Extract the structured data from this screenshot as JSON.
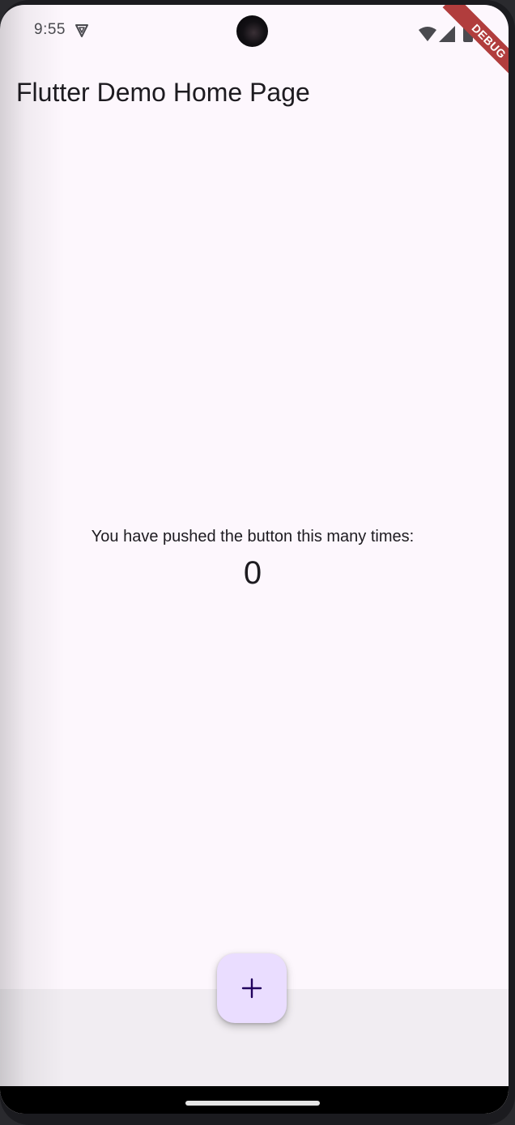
{
  "status_bar": {
    "time": "9:55",
    "icons": [
      "vpn-icon",
      "wifi-icon",
      "signal-icon",
      "battery-icon"
    ]
  },
  "debug_banner": {
    "label": "DEBUG",
    "color": "#b13d3d"
  },
  "app_bar": {
    "title": "Flutter Demo Home Page"
  },
  "body": {
    "message": "You have pushed the button this many times:",
    "counter": "0"
  },
  "fab": {
    "icon": "plus-icon",
    "color": "#eaddff"
  },
  "colors": {
    "background": "#fdf7fd",
    "bottom_surface": "#f1edf2",
    "text": "#1d1b20"
  }
}
